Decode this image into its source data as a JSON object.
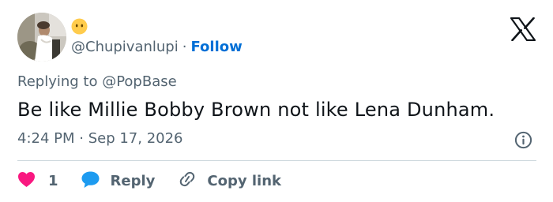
{
  "tweet": {
    "author": {
      "handle": "@Chupivanlupi",
      "separator": "·",
      "follow_label": "Follow",
      "badge_icon": "neutral-face-emoji-icon",
      "avatar_icon": "profile-photo"
    },
    "replying_to": "Replying to @PopBase",
    "text": "Be like Millie Bobby Brown not like Lena Dunham.",
    "timestamp": "4:24 PM · Sep 17, 2026",
    "info_icon": "info-icon",
    "brand_icon": "x-logo-icon"
  },
  "actions": {
    "like": {
      "icon": "heart-icon",
      "count": "1"
    },
    "reply": {
      "icon": "speech-bubble-icon",
      "label": "Reply"
    },
    "copy_link": {
      "icon": "link-icon",
      "label": "Copy link"
    }
  },
  "colors": {
    "text_primary": "#0f1419",
    "text_secondary": "#536471",
    "follow_blue": "#006fd6",
    "like_pink": "#f91880",
    "reply_blue": "#1d9bf0",
    "divider": "#cfd9de"
  }
}
